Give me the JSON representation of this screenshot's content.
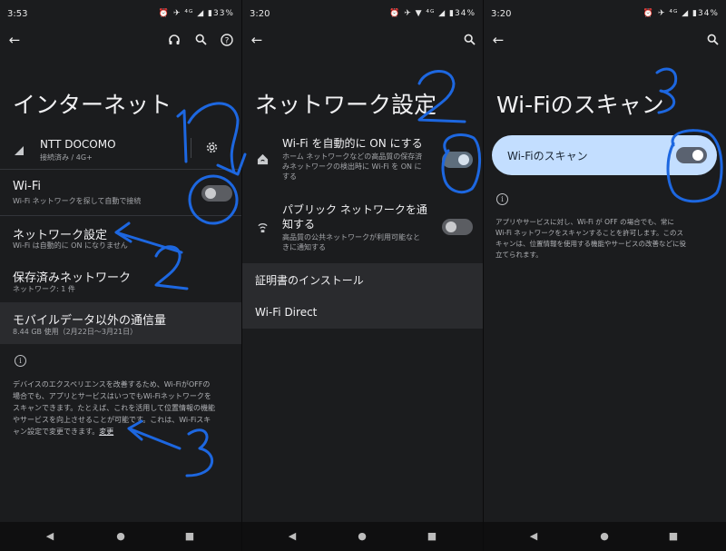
{
  "panel1": {
    "status": {
      "time": "3:53",
      "icons": "⏰ ✈ ⁴ᴳ ◢ ▮33%"
    },
    "title": "インターネット",
    "carrier": {
      "name": "NTT DOCOMO",
      "sub": "接続済み / 4G+"
    },
    "wifi": {
      "title": "Wi-Fi",
      "sub": "Wi-Fi ネットワークを探して自動で接続",
      "state": "off"
    },
    "network_settings": {
      "title": "ネットワーク設定",
      "sub": "Wi-Fi は自動的に ON になりません"
    },
    "saved": {
      "title": "保存済みネットワーク",
      "sub": "ネットワーク: 1 件"
    },
    "data_usage": {
      "title": "モバイルデータ以外の通信量",
      "sub": "8.44 GB 使用（2月22日～3月21日）"
    },
    "info_lines": [
      "デバイスのエクスペリエンスを改善するため、Wi-FiがOFFの",
      "場合でも、アプリとサービスはいつでもWi-Fiネットワークを",
      "スキャンできます。たとえば、これを活用して位置情報の機能",
      "やサービスを向上させることが可能です。これは、Wi-Fiスキ"
    ],
    "info_last": "ャン設定で変更できます。",
    "info_link": "変更"
  },
  "panel2": {
    "status": {
      "time": "3:20",
      "icons": "⏰ ✈ ▼ ⁴ᴳ ◢ ▮34%"
    },
    "title": "ネットワーク設定",
    "auto_wifi": {
      "title": "Wi-Fi を自動的に ON にする",
      "sub_lines": [
        "ホーム ネットワークなどの高品質の保存済",
        "みネットワークの検出時に Wi-Fi を ON に",
        "する"
      ],
      "state": "on"
    },
    "public_notify": {
      "title_lines": [
        "パブリック ネットワークを通",
        "知する"
      ],
      "sub_lines": [
        "高品質の公共ネットワークが利用可能なと",
        "きに通知する"
      ],
      "state": "off"
    },
    "install_cert": "証明書のインストール",
    "wifi_direct": "Wi-Fi Direct"
  },
  "panel3": {
    "status": {
      "time": "3:20",
      "icons": "⏰ ✈ ⁴ᴳ ◢ ▮34%"
    },
    "title": "Wi-Fiのスキャン",
    "scan_toggle": {
      "label": "Wi-Fiのスキャン",
      "state": "on"
    },
    "info_lines": [
      "アプリやサービスに対し、Wi-Fi が OFF の場合でも、常に",
      "Wi-Fi ネットワークをスキャンすることを許可します。このス",
      "キャンは、位置情報を使用する機能やサービスの改善などに役",
      "立てられます。"
    ]
  },
  "annotations": {
    "color": "#1d67e0",
    "p1_nums": [
      "1",
      "2",
      "3"
    ],
    "p2_num": "2",
    "p3_num": "3"
  },
  "icons": {
    "back": "back-arrow-icon",
    "help": "help-icon",
    "search": "search-icon",
    "headset": "headset-icon",
    "settings": "gear-icon",
    "signal": "signal-icon",
    "home_wifi": "home-wifi-icon",
    "wifi_notify": "wifi-notification-icon",
    "info": "info-icon"
  }
}
